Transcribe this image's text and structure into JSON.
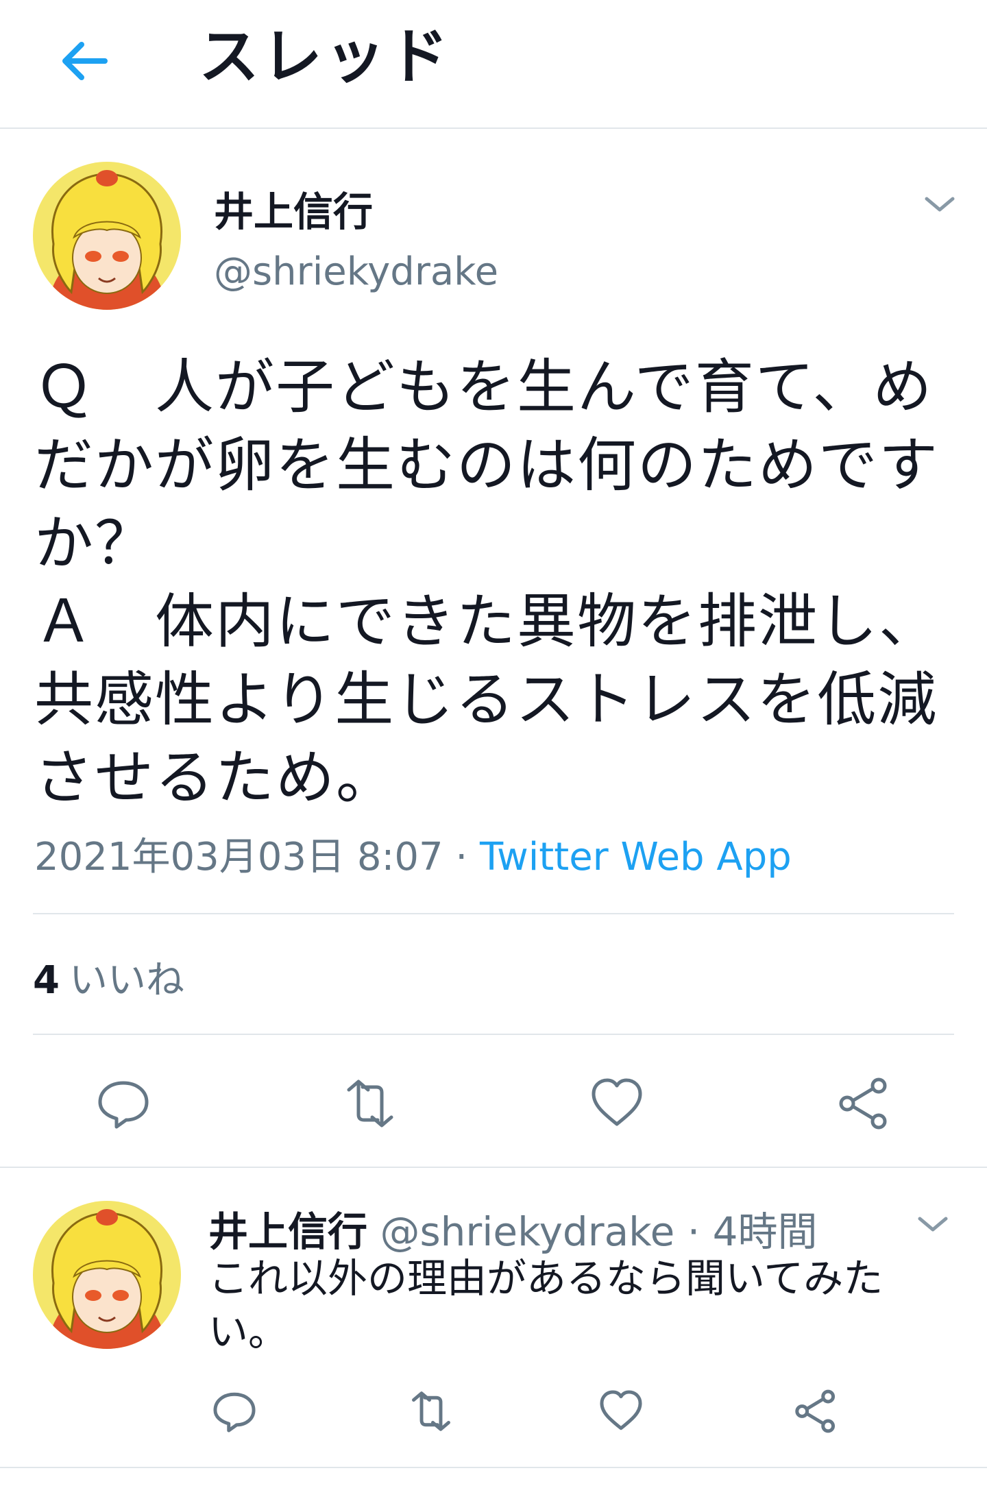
{
  "header": {
    "title": "スレッド"
  },
  "tweet": {
    "display_name": "井上信行",
    "handle": "@shriekydrake",
    "text": "Ｑ　人が子どもを生んで育て、めだかが卵を生むのは何のためですか？\nＡ　体内にできた異物を排泄し、共感性より生じるストレスを低減させるため。",
    "date": "2021年03月03日 8:07",
    "separator": " · ",
    "source": "Twitter Web App",
    "likes_count": "4",
    "likes_label": "いいね"
  },
  "reply": {
    "display_name": "井上信行",
    "handle": "@shriekydrake",
    "separator": " · ",
    "time": "4時間",
    "text": "これ以外の理由があるなら聞いてみたい。"
  },
  "colors": {
    "accent": "#1da1f2",
    "muted": "#657786",
    "text": "#141823",
    "divider": "#e1e6ea"
  },
  "icons": [
    "back-arrow-icon",
    "chevron-down-icon",
    "reply-icon",
    "retweet-icon",
    "like-icon",
    "share-icon"
  ]
}
